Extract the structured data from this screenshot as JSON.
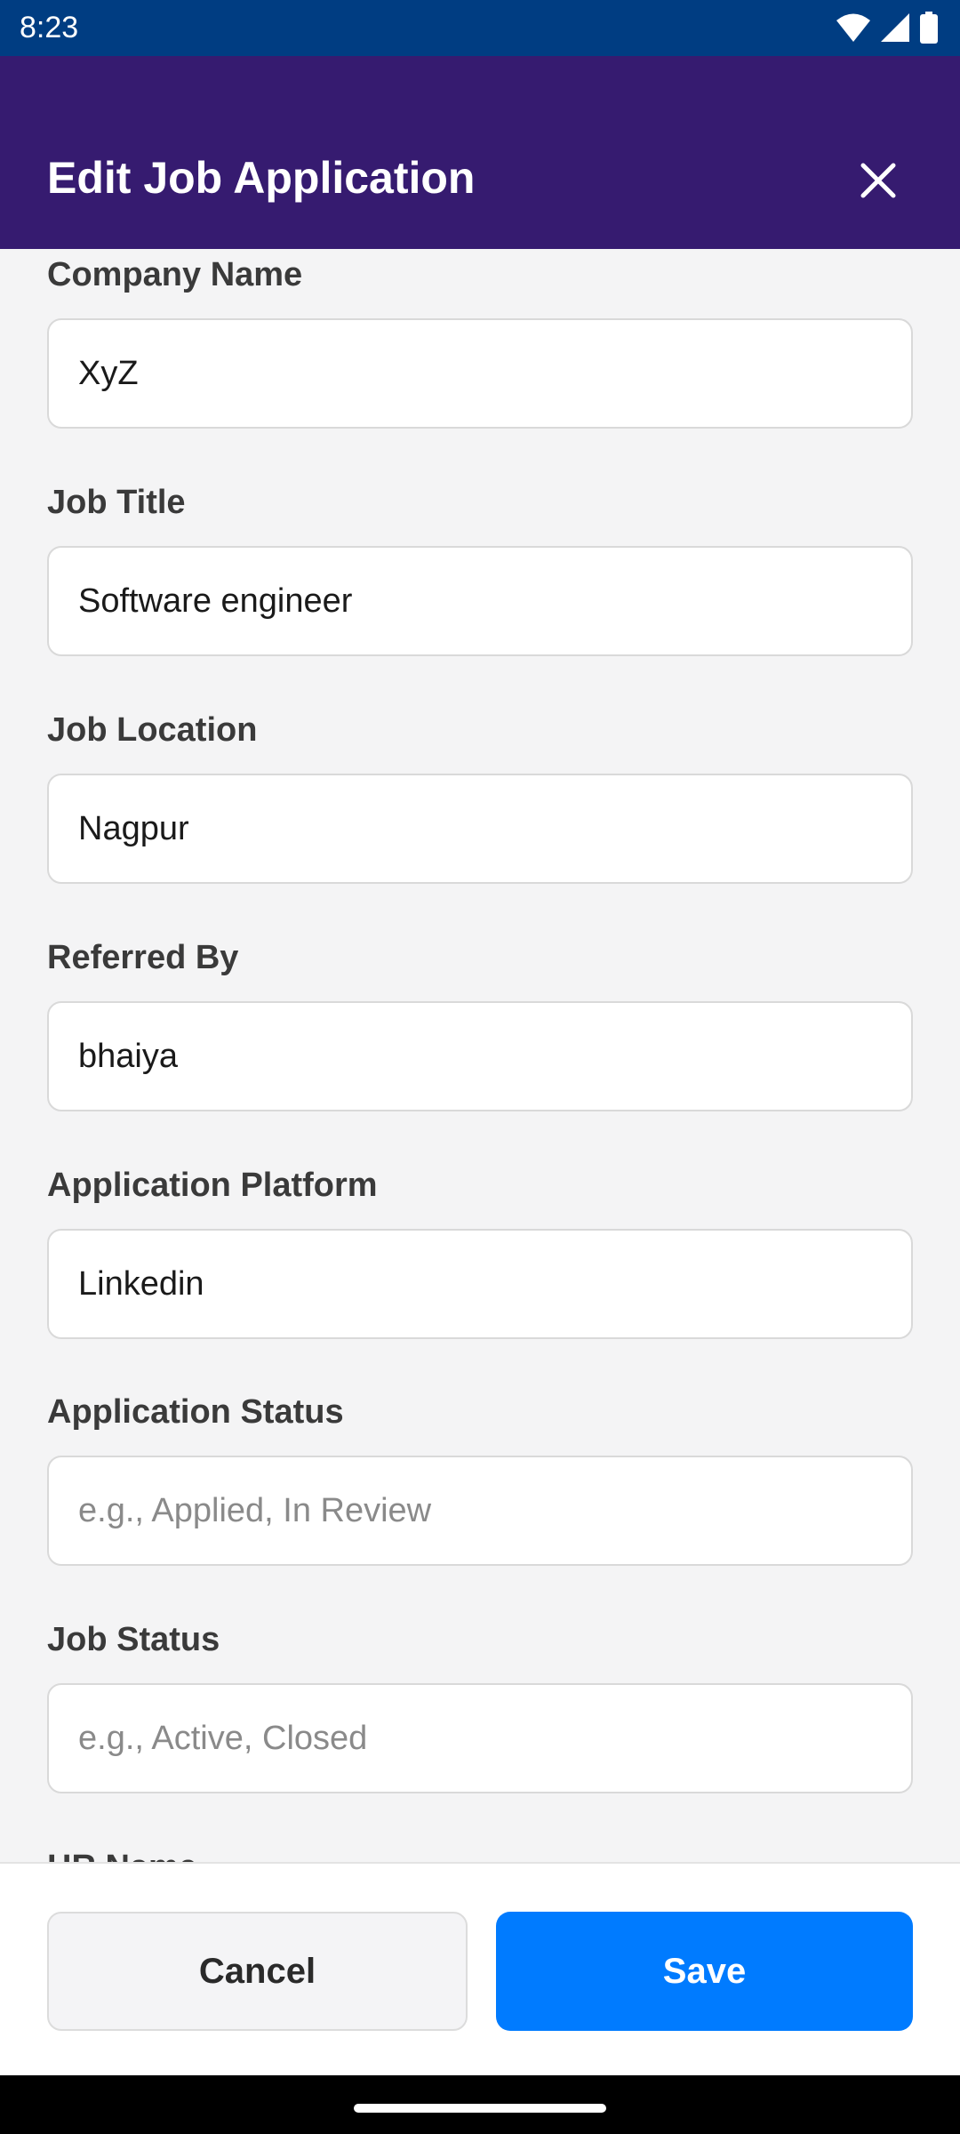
{
  "status_bar": {
    "time": "8:23",
    "icons": [
      "wifi-icon",
      "signal-icon",
      "battery-icon"
    ]
  },
  "header": {
    "title": "Edit Job Application",
    "close_icon": "close-icon"
  },
  "form": {
    "fields": [
      {
        "label": "Company Name",
        "value": "XyZ",
        "placeholder": ""
      },
      {
        "label": "Job Title",
        "value": "Software engineer",
        "placeholder": ""
      },
      {
        "label": "Job Location",
        "value": "Nagpur",
        "placeholder": ""
      },
      {
        "label": "Referred By",
        "value": "bhaiya",
        "placeholder": ""
      },
      {
        "label": "Application Platform",
        "value": "Linkedin",
        "placeholder": ""
      },
      {
        "label": "Application Status",
        "value": "",
        "placeholder": "e.g., Applied, In Review"
      },
      {
        "label": "Job Status",
        "value": "",
        "placeholder": "e.g., Active, Closed"
      },
      {
        "label": "HR Name",
        "value": "",
        "placeholder": ""
      }
    ]
  },
  "footer": {
    "cancel_label": "Cancel",
    "save_label": "Save"
  },
  "colors": {
    "status_bar": "#003d82",
    "app_bar": "#361b70",
    "background": "#f4f4f5",
    "save_button": "#007bff"
  }
}
